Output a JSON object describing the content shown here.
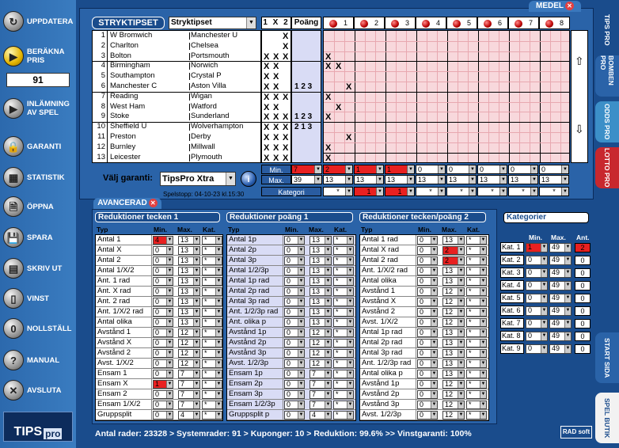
{
  "sidebar": {
    "buttons": [
      {
        "label": "UPPDATERA"
      },
      {
        "label": "BERÄKNA PRIS"
      },
      {
        "label": "INLÄMNING AV SPEL"
      },
      {
        "label": "GARANTI"
      },
      {
        "label": "STATISTIK"
      },
      {
        "label": "ÖPPNA"
      },
      {
        "label": "SPARA"
      },
      {
        "label": "SKRIV UT"
      },
      {
        "label": "VINST"
      },
      {
        "label": "NOLLSTÄLL"
      },
      {
        "label": "MANUAL"
      },
      {
        "label": "AVSLUTA"
      }
    ],
    "price": "91",
    "logo_text": "TIPS",
    "logo_pro": "pro"
  },
  "right_tabs": [
    "TIPS PRO",
    "BOMBEN PRO",
    "ODDS PRO",
    "LOTTO PRO",
    "START SIDA",
    "SPEL BUTIK"
  ],
  "top": {
    "medel_tab": "MEDEL",
    "title": "STRYKTIPSET",
    "game_select": "Stryktipset",
    "x12_header": "1 X 2",
    "poang_header": "Poäng",
    "matches": [
      {
        "n": "1",
        "home": "W Bromwich",
        "away": "Manchester U"
      },
      {
        "n": "2",
        "home": "Charlton",
        "away": "Chelsea"
      },
      {
        "n": "3",
        "home": "Bolton",
        "away": "Portsmouth"
      },
      {
        "n": "4",
        "home": "Birmingham",
        "away": "Norwich"
      },
      {
        "n": "5",
        "home": "Southampton",
        "away": "Crystal P"
      },
      {
        "n": "6",
        "home": "Manchester C",
        "away": "Aston Villa"
      },
      {
        "n": "7",
        "home": "Reading",
        "away": "Wigan"
      },
      {
        "n": "8",
        "home": "West Ham",
        "away": "Watford"
      },
      {
        "n": "9",
        "home": "Stoke",
        "away": "Sunderland"
      },
      {
        "n": "10",
        "home": "Sheffield U",
        "away": "Wolverhampton"
      },
      {
        "n": "11",
        "home": "Preston",
        "away": "Derby"
      },
      {
        "n": "12",
        "home": "Burnley",
        "away": "Millwall"
      },
      {
        "n": "13",
        "home": "Leicester",
        "away": "Plymouth"
      }
    ],
    "x12_marks": [
      "  X",
      "  X",
      "XXX",
      "XX ",
      "XX ",
      "XX ",
      "XXX",
      "XX ",
      "XXX",
      "XXX",
      "XXX",
      "XXX",
      "XXX"
    ],
    "poang": [
      "",
      "",
      "",
      "",
      "",
      "1 2 3",
      "",
      "",
      "1 2 3",
      "2 1 3",
      "",
      "",
      ""
    ],
    "group_headers": [
      "1",
      "2",
      "3",
      "4",
      "5",
      "6",
      "7",
      "8"
    ],
    "group_marks": [
      {
        "row": 3,
        "col": 1
      },
      {
        "row": 4,
        "col": 1
      },
      {
        "row": 4,
        "col": 2
      },
      {
        "row": 6,
        "col": 3
      },
      {
        "row": 7,
        "col": 1
      },
      {
        "row": 8,
        "col": 2
      },
      {
        "row": 9,
        "col": 1
      },
      {
        "row": 11,
        "col": 3
      },
      {
        "row": 12,
        "col": 1
      },
      {
        "row": 13,
        "col": 1
      }
    ],
    "min_label": "Min.",
    "max_label": "Max.",
    "kategori_label": "Kategori",
    "min_values": [
      "7",
      "2",
      "1",
      "1",
      "0",
      "0",
      "0",
      "0",
      "0"
    ],
    "min_red": [
      true,
      true,
      true,
      true,
      false,
      false,
      false,
      false,
      false
    ],
    "max_values": [
      "39",
      "13",
      "13",
      "13",
      "13",
      "13",
      "13",
      "13",
      "13"
    ],
    "kat_values": [
      "*",
      "*",
      "1",
      "1",
      "*",
      "*",
      "*",
      "*",
      "*"
    ],
    "kat_red": [
      false,
      false,
      true,
      true,
      false,
      false,
      false,
      false,
      false
    ],
    "garanti_label": "Välj garanti:",
    "garanti_value": "TipsPro Xtra",
    "spelstopp": "Spelstopp: 04-10-23 kl.15:30"
  },
  "avancerad": {
    "tab": "AVANCERAD",
    "col_typ": "Typ",
    "col_min": "Min.",
    "col_max": "Max.",
    "col_kat": "Kat.",
    "sections": [
      {
        "title": "Reduktioner tecken 1",
        "rows": [
          {
            "label": "Antal 1",
            "min": "4",
            "max": "13",
            "kat": "*",
            "min_red": true
          },
          {
            "label": "Antal X",
            "min": "0",
            "max": "13",
            "kat": "*"
          },
          {
            "label": "Antal 2",
            "min": "0",
            "max": "13",
            "kat": "*"
          },
          {
            "label": "Antal 1/X/2",
            "min": "0",
            "max": "13",
            "kat": "*"
          },
          {
            "label": "Ant. 1 rad",
            "min": "0",
            "max": "13",
            "kat": "*"
          },
          {
            "label": "Ant. X rad",
            "min": "0",
            "max": "13",
            "kat": "*"
          },
          {
            "label": "Ant. 2 rad",
            "min": "0",
            "max": "13",
            "kat": "*"
          },
          {
            "label": "Ant. 1/X/2 rad",
            "min": "0",
            "max": "13",
            "kat": "*"
          },
          {
            "label": "Antal olika",
            "min": "0",
            "max": "13",
            "kat": "*"
          },
          {
            "label": "Avstånd 1",
            "min": "0",
            "max": "12",
            "kat": "*"
          },
          {
            "label": "Avstånd X",
            "min": "0",
            "max": "12",
            "kat": "*"
          },
          {
            "label": "Avstånd 2",
            "min": "0",
            "max": "12",
            "kat": "*"
          },
          {
            "label": "Avst. 1/X/2",
            "min": "0",
            "max": "12",
            "kat": "*"
          },
          {
            "label": "Ensam 1",
            "min": "0",
            "max": "7",
            "kat": "*"
          },
          {
            "label": "Ensam X",
            "min": "1",
            "max": "7",
            "kat": "*",
            "min_red": true
          },
          {
            "label": "Ensam 2",
            "min": "0",
            "max": "7",
            "kat": "*"
          },
          {
            "label": "Ensam 1/X/2",
            "min": "0",
            "max": "7",
            "kat": "*"
          },
          {
            "label": "Gruppsplit",
            "min": "0",
            "max": "4",
            "kat": "*"
          }
        ]
      },
      {
        "title": "Reduktioner poäng 1",
        "rows": [
          {
            "label": "Antal 1p",
            "min": "0",
            "max": "13",
            "kat": "*"
          },
          {
            "label": "Antal 2p",
            "min": "0",
            "max": "13",
            "kat": "*"
          },
          {
            "label": "Antal 3p",
            "min": "0",
            "max": "13",
            "kat": "*"
          },
          {
            "label": "Antal 1/2/3p",
            "min": "0",
            "max": "13",
            "kat": "*"
          },
          {
            "label": "Antal 1p rad",
            "min": "0",
            "max": "13",
            "kat": "*"
          },
          {
            "label": "Antal 2p rad",
            "min": "0",
            "max": "13",
            "kat": "*"
          },
          {
            "label": "Antal 3p rad",
            "min": "0",
            "max": "13",
            "kat": "*"
          },
          {
            "label": "Ant. 1/2/3p rad",
            "min": "0",
            "max": "13",
            "kat": "*"
          },
          {
            "label": "Ant. olika p",
            "min": "0",
            "max": "13",
            "kat": "*"
          },
          {
            "label": "Avstånd 1p",
            "min": "0",
            "max": "12",
            "kat": "*"
          },
          {
            "label": "Avstånd 2p",
            "min": "0",
            "max": "12",
            "kat": "*"
          },
          {
            "label": "Avstånd 3p",
            "min": "0",
            "max": "12",
            "kat": "*"
          },
          {
            "label": "Avst. 1/2/3p",
            "min": "0",
            "max": "12",
            "kat": "*"
          },
          {
            "label": "Ensam 1p",
            "min": "0",
            "max": "7",
            "kat": "*"
          },
          {
            "label": "Ensam 2p",
            "min": "0",
            "max": "7",
            "kat": "*"
          },
          {
            "label": "Ensam 3p",
            "min": "0",
            "max": "7",
            "kat": "*"
          },
          {
            "label": "Ensam 1/2/3p",
            "min": "0",
            "max": "7",
            "kat": "*"
          },
          {
            "label": "Gruppsplit p",
            "min": "0",
            "max": "4",
            "kat": "*"
          }
        ]
      },
      {
        "title": "Reduktioner tecken/poäng 2",
        "rows": [
          {
            "label": "Antal 1 rad",
            "min": "0",
            "max": "13",
            "kat": "*"
          },
          {
            "label": "Antal X rad",
            "min": "0",
            "max": "2",
            "kat": "*",
            "max_red": true
          },
          {
            "label": "Antal 2 rad",
            "min": "0",
            "max": "2",
            "kat": "*",
            "max_red": true
          },
          {
            "label": "Ant. 1/X/2 rad",
            "min": "0",
            "max": "13",
            "kat": "*"
          },
          {
            "label": "Antal olika",
            "min": "0",
            "max": "13",
            "kat": "*"
          },
          {
            "label": "Avstånd 1",
            "min": "0",
            "max": "12",
            "kat": "*"
          },
          {
            "label": "Avstånd X",
            "min": "0",
            "max": "12",
            "kat": "*"
          },
          {
            "label": "Avstånd 2",
            "min": "0",
            "max": "12",
            "kat": "*"
          },
          {
            "label": "Avst. 1/X/2",
            "min": "0",
            "max": "12",
            "kat": "*"
          },
          {
            "label": "Antal 1p rad",
            "min": "0",
            "max": "13",
            "kat": "*"
          },
          {
            "label": "Antal 2p rad",
            "min": "0",
            "max": "13",
            "kat": "*"
          },
          {
            "label": "Antal 3p rad",
            "min": "0",
            "max": "13",
            "kat": "*"
          },
          {
            "label": "Ant. 1/2/3p rad",
            "min": "0",
            "max": "13",
            "kat": "*"
          },
          {
            "label": "Antal olika p",
            "min": "0",
            "max": "13",
            "kat": "*"
          },
          {
            "label": "Avstånd 1p",
            "min": "0",
            "max": "12",
            "kat": "*"
          },
          {
            "label": "Avstånd 2p",
            "min": "0",
            "max": "12",
            "kat": "*"
          },
          {
            "label": "Avstånd 3p",
            "min": "0",
            "max": "12",
            "kat": "*"
          },
          {
            "label": "Avst. 1/2/3p",
            "min": "0",
            "max": "12",
            "kat": "*"
          }
        ]
      }
    ]
  },
  "kategorier": {
    "title": "Kategorier",
    "col_min": "Min.",
    "col_max": "Max.",
    "col_ant": "Ant.",
    "rows": [
      {
        "label": "Kat. 1",
        "min": "1",
        "max": "49",
        "ant": "2",
        "min_red": true,
        "ant_red": true
      },
      {
        "label": "Kat. 2",
        "min": "0",
        "max": "49",
        "ant": "0"
      },
      {
        "label": "Kat. 3",
        "min": "0",
        "max": "49",
        "ant": "0"
      },
      {
        "label": "Kat. 4",
        "min": "0",
        "max": "49",
        "ant": "0"
      },
      {
        "label": "Kat. 5",
        "min": "0",
        "max": "49",
        "ant": "0"
      },
      {
        "label": "Kat. 6",
        "min": "0",
        "max": "49",
        "ant": "0"
      },
      {
        "label": "Kat. 7",
        "min": "0",
        "max": "49",
        "ant": "0"
      },
      {
        "label": "Kat. 8",
        "min": "0",
        "max": "49",
        "ant": "0"
      },
      {
        "label": "Kat. 9",
        "min": "0",
        "max": "49",
        "ant": "0"
      }
    ]
  },
  "status": "Antal rader: 23328  >  Systemrader: 91  >  Kuponger: 10  >  Reduktion: 99.6%  >>  Vinstgaranti: 100%",
  "radsoft": "RAD soft",
  "colors": {
    "accent_red": "#e82020",
    "panel_blue": "#2a63a8",
    "pink_grid": "#f8d8dc",
    "lilac": "#d9dcf5"
  }
}
